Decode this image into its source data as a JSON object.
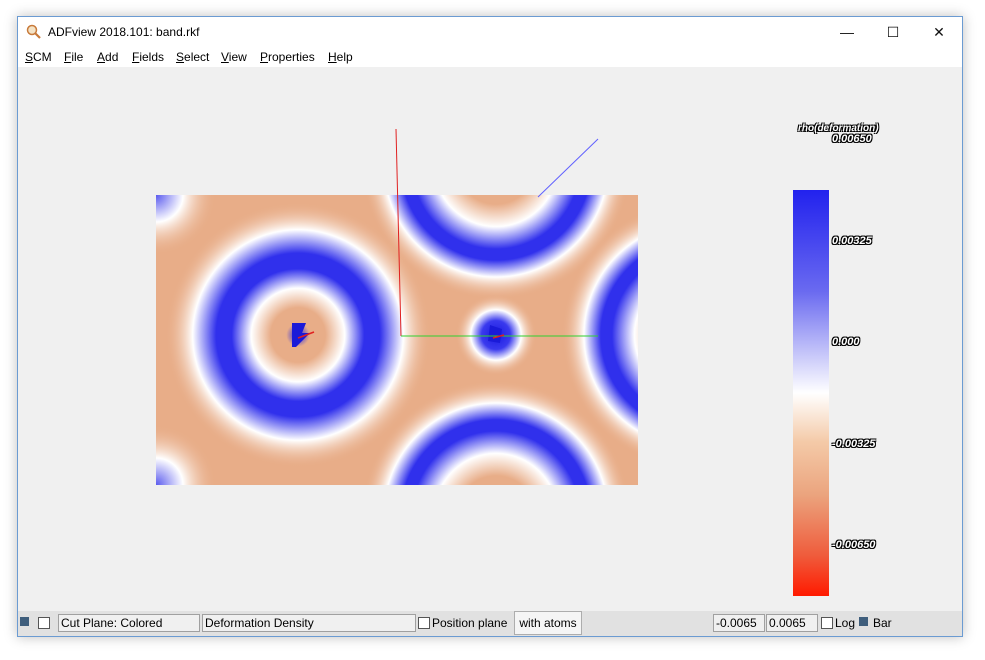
{
  "window": {
    "title": "ADFview 2018.101: band.rkf",
    "controls": {
      "minimize": "—",
      "maximize": "☐",
      "close": "✕"
    }
  },
  "menu": [
    {
      "accel": "S",
      "rest": "CM"
    },
    {
      "accel": "F",
      "rest": "ile"
    },
    {
      "accel": "A",
      "rest": "dd"
    },
    {
      "accel": "F",
      "rest": "ields"
    },
    {
      "accel": "S",
      "rest": "elect"
    },
    {
      "accel": "V",
      "rest": "iew"
    },
    {
      "accel": "P",
      "rest": "roperties"
    },
    {
      "accel": "H",
      "rest": "elp"
    }
  ],
  "colorbar": {
    "title": "rho(deformation)",
    "ticks": [
      "0.00650",
      "0.00325",
      "0.000",
      "-0.00325",
      "-0.00650"
    ],
    "colors": {
      "max": "#2222ee",
      "mid": "#ffffff",
      "min": "#ff1a00",
      "base": "#e8ad88"
    }
  },
  "statusbar": {
    "field_kind": "Cut Plane: Colored",
    "field_name": "Deformation Density",
    "position_plane": "Position plane",
    "with_atoms": "with atoms",
    "range_min": "-0.0065",
    "range_max": "0.0065",
    "log": "Log",
    "bar": "Bar"
  }
}
